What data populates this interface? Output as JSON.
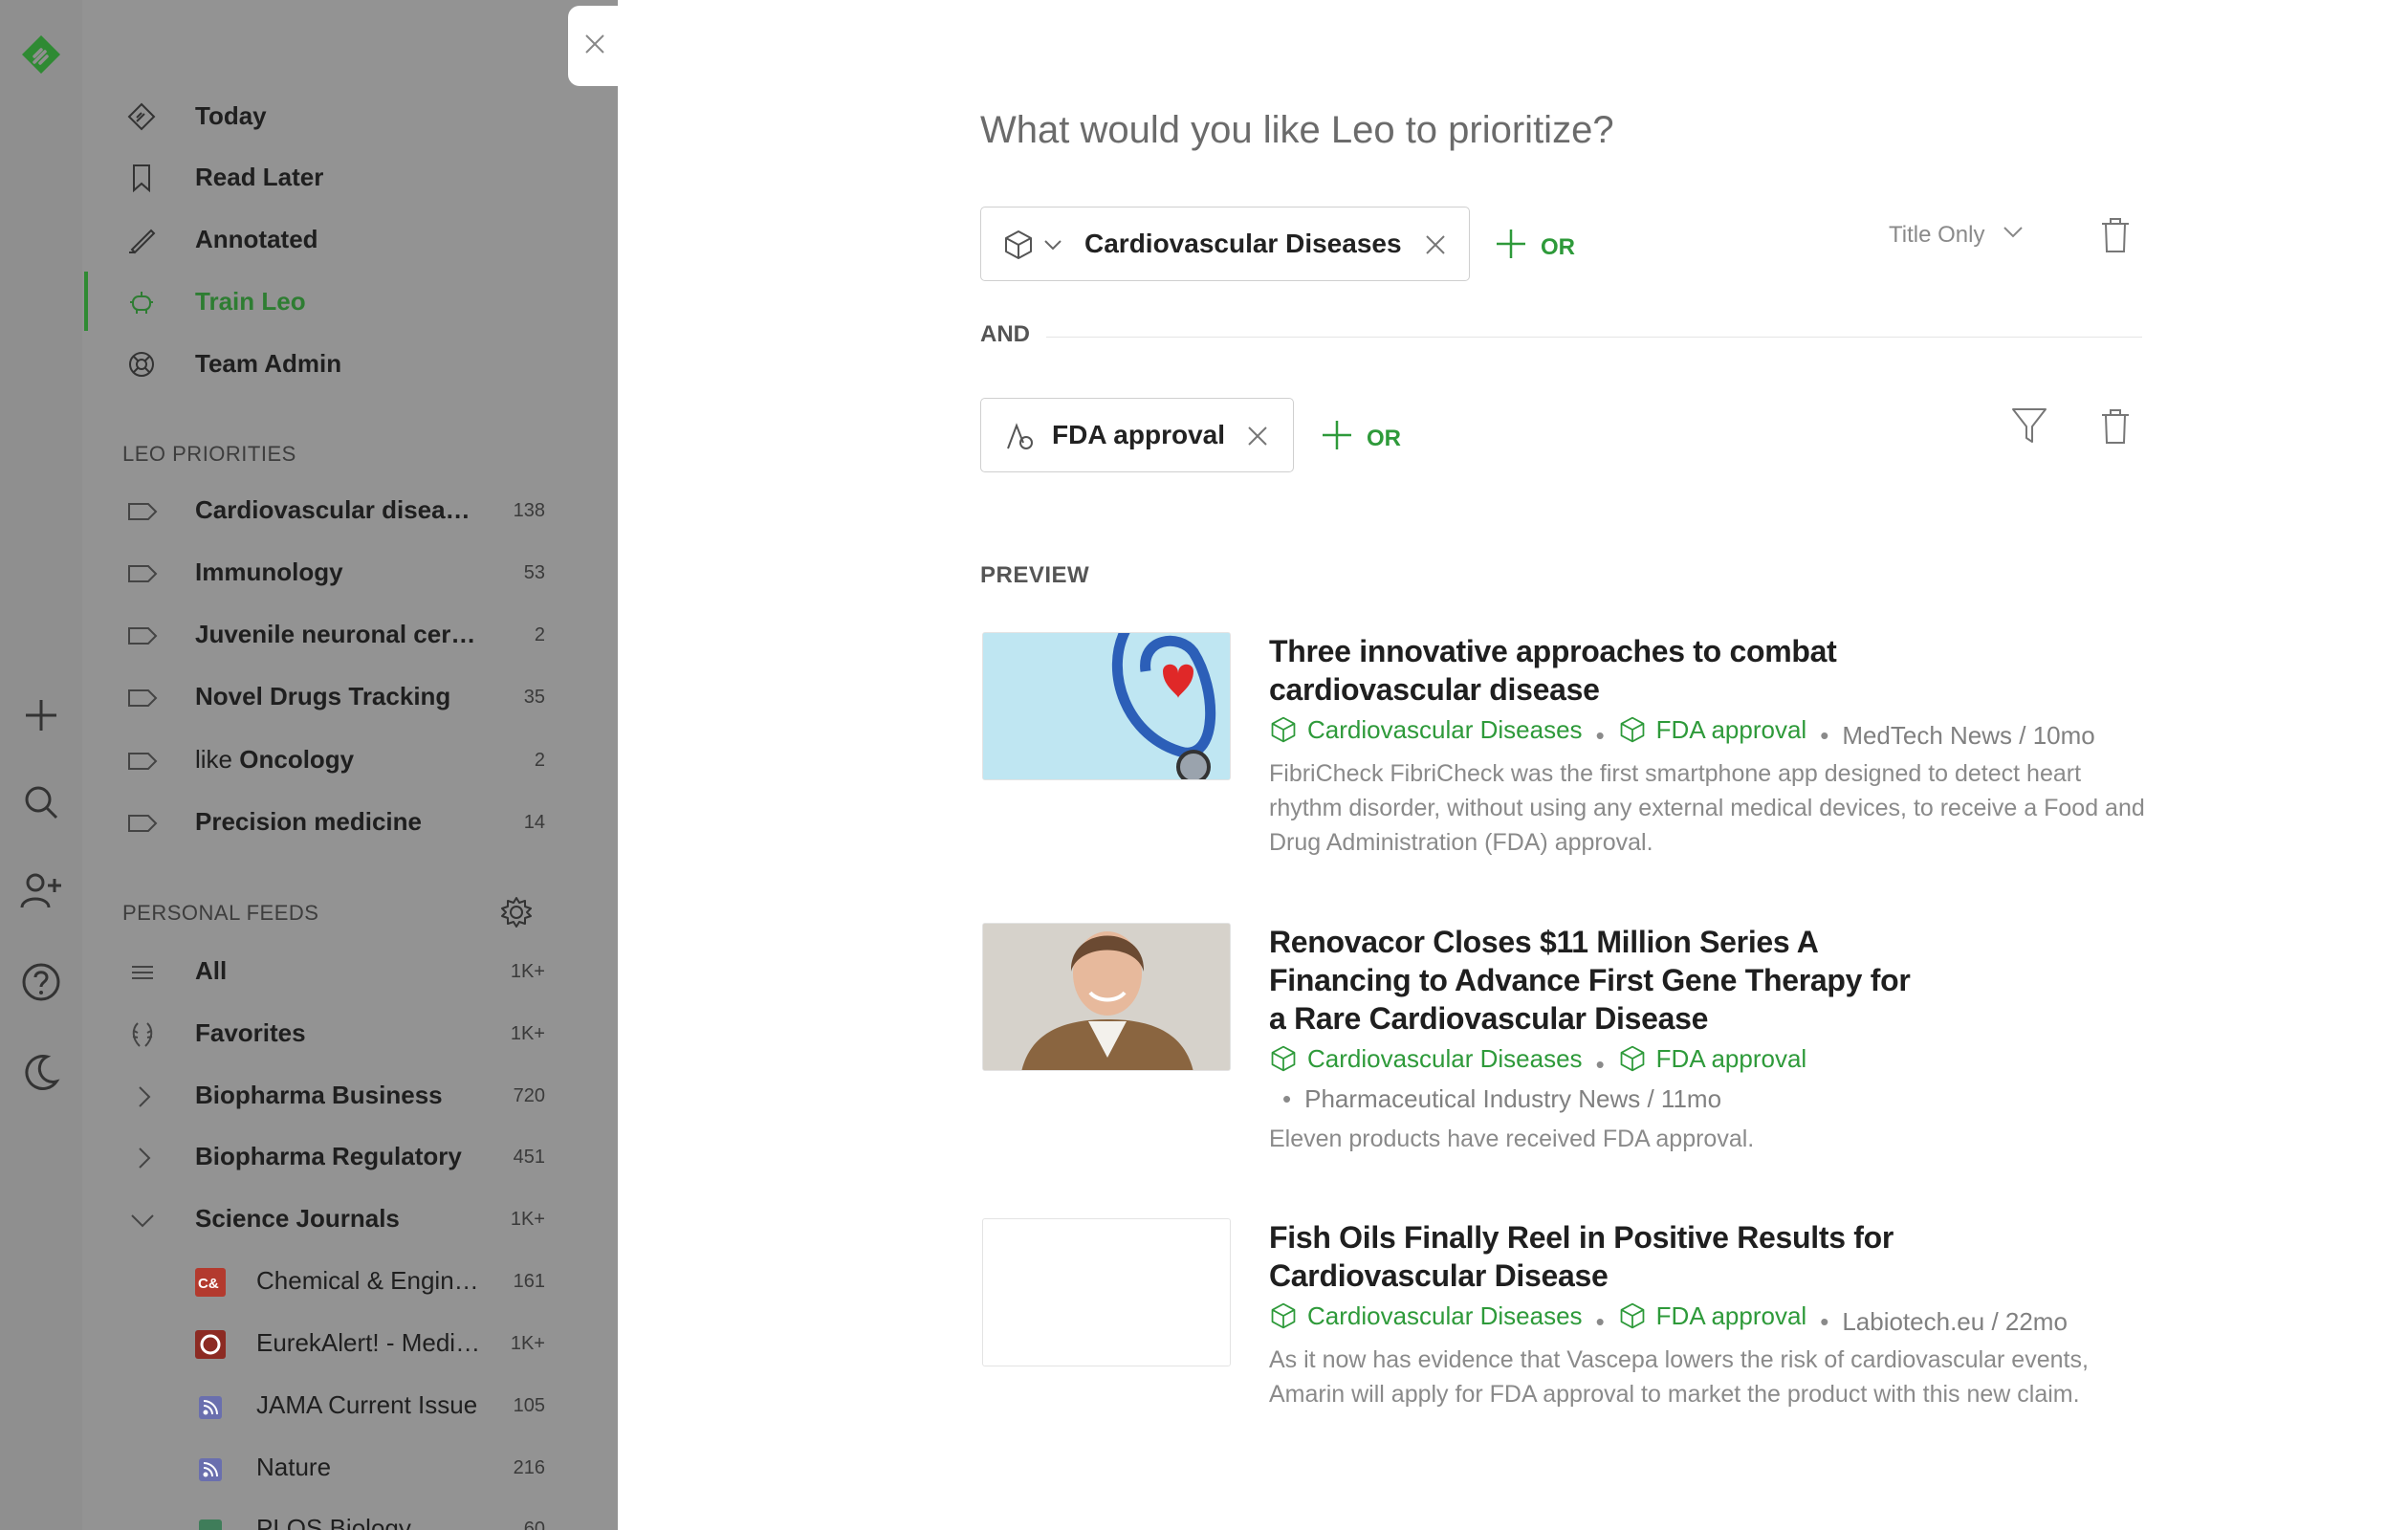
{
  "sidebar": {
    "nav": [
      {
        "label": "Today",
        "icon": "today-icon"
      },
      {
        "label": "Read Later",
        "icon": "bookmark-icon"
      },
      {
        "label": "Annotated",
        "icon": "highlighter-icon"
      },
      {
        "label": "Train Leo",
        "icon": "leo-icon",
        "active": true
      },
      {
        "label": "Team Admin",
        "icon": "lifebuoy-icon"
      }
    ],
    "priorities_title": "LEO PRIORITIES",
    "priorities": [
      {
        "label": "Cardiovascular disea…",
        "count": "138"
      },
      {
        "label": "Immunology",
        "count": "53"
      },
      {
        "label": "Juvenile neuronal cer…",
        "count": "2"
      },
      {
        "label": "Novel Drugs Tracking",
        "count": "35"
      },
      {
        "prefix": "like ",
        "label": "Oncology",
        "count": "2"
      },
      {
        "label": "Precision medicine",
        "count": "14"
      }
    ],
    "feeds_title": "PERSONAL FEEDS",
    "feeds": [
      {
        "label": "All",
        "count": "1K+"
      },
      {
        "label": "Favorites",
        "count": "1K+"
      },
      {
        "label": "Biopharma Business",
        "count": "720"
      },
      {
        "label": "Biopharma Regulatory",
        "count": "451"
      },
      {
        "label": "Science Journals",
        "count": "1K+"
      }
    ],
    "sources": [
      {
        "label": "Chemical & Engin…",
        "count": "161"
      },
      {
        "label": "EurekAlert! - Medi…",
        "count": "1K+"
      },
      {
        "label": "JAMA Current Issue",
        "count": "105"
      },
      {
        "label": "Nature",
        "count": "216"
      },
      {
        "label": "PLOS Biology",
        "count": "60"
      }
    ]
  },
  "main": {
    "title": "What would you like Leo to prioritize?",
    "rule1": {
      "chip": "Cardiovascular Diseases",
      "or": "OR",
      "scope": "Title Only"
    },
    "and_label": "AND",
    "rule2": {
      "chip": "FDA approval",
      "or": "OR"
    },
    "preview_label": "PREVIEW",
    "articles": [
      {
        "title": "Three innovative approaches to combat cardiovascular disease",
        "tag1": "Cardiovascular Diseases",
        "tag2": "FDA approval",
        "source": "MedTech News / 10mo",
        "desc": "FibriCheck FibriCheck was the first smartphone app designed to detect heart rhythm disorder, without using any external medical devices, to receive a Food and Drug Administration (FDA) approval."
      },
      {
        "title": "Renovacor Closes $11 Million Series A Financing to Advance First Gene Therapy for a Rare Cardiovascular Disease",
        "tag1": "Cardiovascular Diseases",
        "tag2": "FDA approval",
        "source": "Pharmaceutical Industry News / 11mo",
        "desc": "Eleven products have received FDA approval."
      },
      {
        "title": "Fish Oils Finally Reel in Positive Results for Cardiovascular Disease",
        "tag1": "Cardiovascular Diseases",
        "tag2": "FDA approval",
        "source": "Labiotech.eu / 22mo",
        "desc": "As it now has evidence that Vascepa lowers the risk of cardiovascular events, Amarin will apply for FDA approval to market the product with this new claim."
      }
    ]
  },
  "colors": {
    "accent": "#2e9a3a",
    "sidebar_bg": "#939393",
    "rail_bg": "#8f8f8f"
  }
}
